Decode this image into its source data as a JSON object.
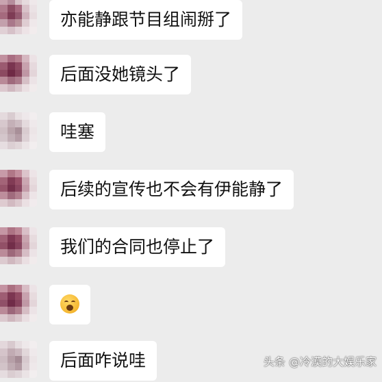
{
  "messages": [
    {
      "text": "亦能静跟节目组闹掰了",
      "type": "text"
    },
    {
      "text": "后面没她镜头了",
      "type": "text"
    },
    {
      "text": "哇塞",
      "type": "text"
    },
    {
      "text": "后续的宣传也不会有伊能静了",
      "type": "text"
    },
    {
      "text": "我们的合同也停止了",
      "type": "text"
    },
    {
      "text": "",
      "type": "emoji",
      "icon": "shocked-face-emoji"
    },
    {
      "text": "后面咋说哇",
      "type": "text"
    }
  ],
  "watermark": "头条 @冷漠的大娱乐家",
  "colors": {
    "background": "#ececec",
    "bubble": "#ffffff",
    "text": "#111111"
  }
}
